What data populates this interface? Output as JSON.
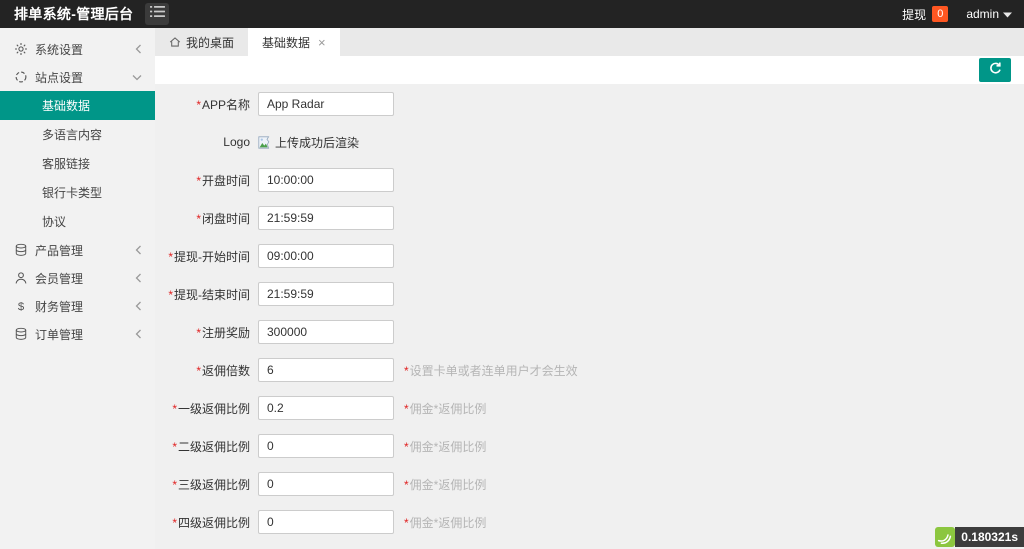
{
  "colors": {
    "accent": "#009688",
    "badge_orange": "#ff5722",
    "header_bg": "#232323",
    "trace_green": "#8cc63f",
    "required_red": "#e02222"
  },
  "header": {
    "title": "排单系统-管理后台",
    "withdraw_label": "提现",
    "withdraw_badge": "0",
    "username": "admin"
  },
  "sidebar": {
    "items": [
      {
        "id": "system-settings",
        "icon": "gear",
        "label": "系统设置",
        "expanded": false
      },
      {
        "id": "site-settings",
        "icon": "site",
        "label": "站点设置",
        "expanded": true,
        "children": [
          {
            "id": "basic-data",
            "label": "基础数据",
            "active": true
          },
          {
            "id": "multi-language",
            "label": "多语言内容",
            "active": false
          },
          {
            "id": "service-link",
            "label": "客服链接",
            "active": false
          },
          {
            "id": "bank-card-type",
            "label": "银行卡类型",
            "active": false
          },
          {
            "id": "agreement",
            "label": "协议",
            "active": false
          }
        ]
      },
      {
        "id": "product-management",
        "icon": "coins",
        "label": "产品管理",
        "expanded": false
      },
      {
        "id": "member-management",
        "icon": "user",
        "label": "会员管理",
        "expanded": false
      },
      {
        "id": "finance-management",
        "icon": "dollar",
        "label": "财务管理",
        "expanded": false
      },
      {
        "id": "order-management",
        "icon": "order",
        "label": "订单管理",
        "expanded": false
      }
    ]
  },
  "tabs": [
    {
      "id": "desktop",
      "icon": "home",
      "label": "我的桌面",
      "active": false,
      "closable": false
    },
    {
      "id": "basic-data",
      "label": "基础数据",
      "active": true,
      "closable": true
    }
  ],
  "form": {
    "fields": [
      {
        "id": "app-name",
        "label": "APP名称",
        "required": true,
        "type": "text",
        "value": "App Radar"
      },
      {
        "id": "logo",
        "label": "Logo",
        "required": false,
        "type": "image",
        "alt": "上传成功后渲染"
      },
      {
        "id": "open-time",
        "label": "开盘时间",
        "required": true,
        "type": "text",
        "value": "10:00:00"
      },
      {
        "id": "close-time",
        "label": "闭盘时间",
        "required": true,
        "type": "text",
        "value": "21:59:59"
      },
      {
        "id": "withdraw-start-time",
        "label": "提现-开始时间",
        "required": true,
        "type": "text",
        "value": "09:00:00"
      },
      {
        "id": "withdraw-end-time",
        "label": "提现-结束时间",
        "required": true,
        "type": "text",
        "value": "21:59:59"
      },
      {
        "id": "register-reward",
        "label": "注册奖励",
        "required": true,
        "type": "text",
        "value": "300000"
      },
      {
        "id": "rebate-multiple",
        "label": "返佣倍数",
        "required": true,
        "type": "text",
        "value": "6",
        "hint": "设置卡单或者连单用户才会生效"
      },
      {
        "id": "rebate-level1",
        "label": "一级返佣比例",
        "required": true,
        "type": "text",
        "value": "0.2",
        "hint": "佣金*返佣比例"
      },
      {
        "id": "rebate-level2",
        "label": "二级返佣比例",
        "required": true,
        "type": "text",
        "value": "0",
        "hint": "佣金*返佣比例"
      },
      {
        "id": "rebate-level3",
        "label": "三级返佣比例",
        "required": true,
        "type": "text",
        "value": "0",
        "hint": "佣金*返佣比例"
      },
      {
        "id": "rebate-level4",
        "label": "四级返佣比例",
        "required": true,
        "type": "text",
        "value": "0",
        "hint": "佣金*返佣比例"
      }
    ]
  },
  "trace": {
    "time": "0.180321s"
  }
}
